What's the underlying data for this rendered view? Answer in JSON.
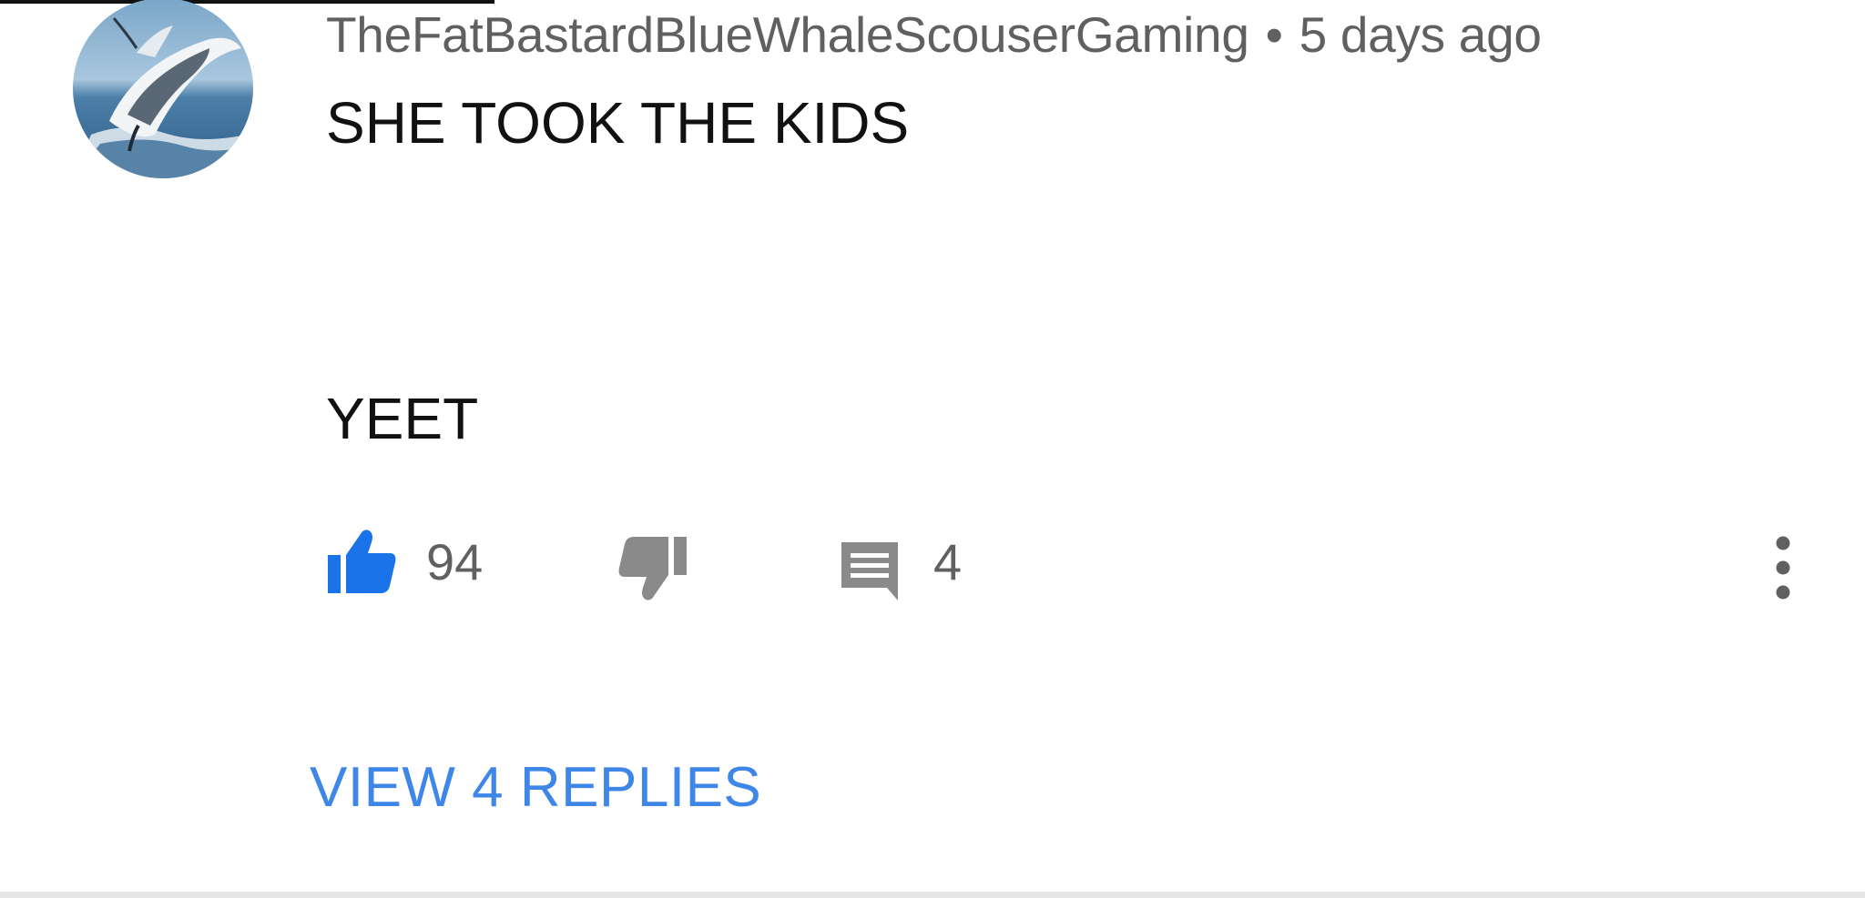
{
  "comment": {
    "author": "TheFatBastardBlueWhaleScouserGaming",
    "separator": "•",
    "timestamp": "5 days ago",
    "lines": [
      "SHE TOOK THE KIDS",
      "________________",
      "YEET"
    ],
    "likes": "94",
    "replies_count": "4",
    "view_replies_label": "VIEW 4 REPLIES"
  },
  "icons": {
    "like": "thumbs-up-icon",
    "dislike": "thumbs-down-icon",
    "reply": "comment-icon",
    "more": "more-vertical-icon"
  },
  "colors": {
    "like_active": "#1a73e8",
    "icon_gray": "#8a8a8a",
    "link_blue": "#3e86e8",
    "meta_text": "#606060",
    "body_text": "#111111"
  }
}
